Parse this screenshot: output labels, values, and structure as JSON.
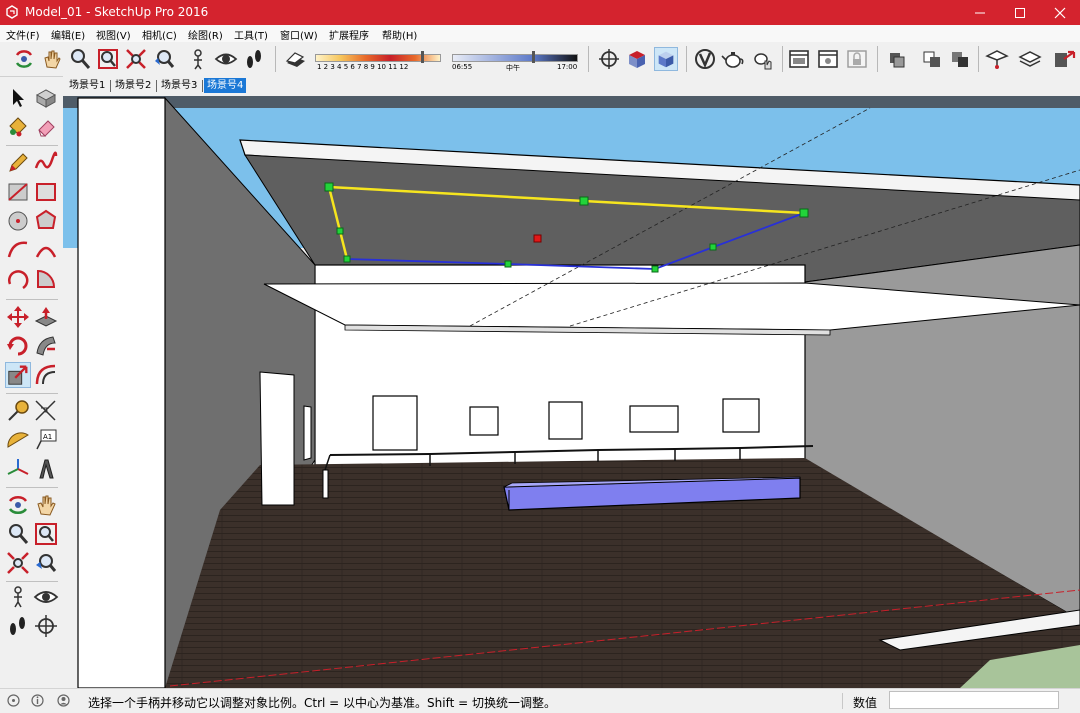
{
  "window": {
    "title": "Model_01 - SketchUp Pro 2016",
    "accent_color": "#d4232e"
  },
  "menu": [
    "文件(F)",
    "编辑(E)",
    "视图(V)",
    "相机(C)",
    "绘图(R)",
    "工具(T)",
    "窗口(W)",
    "扩展程序",
    "帮助(H)"
  ],
  "toolbar": {
    "icons": [
      "orbit-icon",
      "pan-icon",
      "zoom-icon",
      "zoom-window-icon",
      "zoom-extents-icon",
      "previous-view-icon",
      "position-camera-icon",
      "look-around-icon",
      "walk-icon",
      "shadows-icon",
      "section-plane-icon",
      "top-view-icon",
      "iso-view-icon",
      "extension-v-icon",
      "teapot-icon",
      "teapot-hand-icon",
      "window-1-icon",
      "window-2-icon",
      "lock-icon",
      "component-1-icon",
      "component-2-icon",
      "component-3-icon",
      "warehouse-icon",
      "layers-icon",
      "export-icon"
    ],
    "shadow_month_ticks": "1 2 3 4 5 6 7 8 9 10 11 12",
    "shadow_time_start": "06:55",
    "shadow_time_mid": "中午",
    "shadow_time_end": "17:00"
  },
  "scene_tabs": [
    {
      "label": "场景号1",
      "active": false
    },
    {
      "label": "场景号2",
      "active": false
    },
    {
      "label": "场景号3",
      "active": false
    },
    {
      "label": "场景号4",
      "active": true
    }
  ],
  "left_tools": [
    "select-icon",
    "make-component-icon",
    "paint-bucket-icon",
    "eraser-icon",
    "pencil-icon",
    "freehand-icon",
    "rectangle-icon",
    "rotated-rectangle-icon",
    "circle-icon",
    "polygon-icon",
    "arc-icon",
    "two-point-arc-icon",
    "three-point-arc-icon",
    "pie-icon",
    "move-icon",
    "push-pull-icon",
    "rotate-icon",
    "follow-me-icon",
    "scale-icon",
    "offset-icon",
    "tape-measure-icon",
    "dimension-icon",
    "protractor-icon",
    "text-icon",
    "axes-icon",
    "3d-text-icon",
    "orbit-icon",
    "pan-icon",
    "zoom-icon",
    "zoom-window-icon",
    "zoom-extents-icon",
    "previous-icon",
    "position-camera-icon",
    "look-around-icon",
    "walk-icon",
    "section-icon"
  ],
  "status": {
    "hint": "选择一个手柄并移动它以调整对象比例。Ctrl = 以中心为基准。Shift = 切换统一调整。",
    "value_label": "数值",
    "value": ""
  }
}
